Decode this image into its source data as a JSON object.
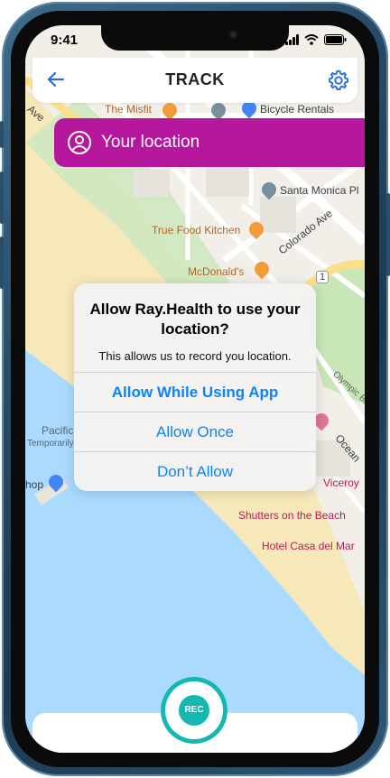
{
  "status_bar": {
    "time": "9:41"
  },
  "header": {
    "title": "TRACK"
  },
  "location_bar": {
    "label": "Your location"
  },
  "map": {
    "labels": {
      "misfit": "The Misfit",
      "bicycle_rentals": "Bicycle Rentals",
      "santa_monica": "Santa Monica Pl",
      "true_food": "True Food Kitchen",
      "colorado_ave": "Colorado Ave",
      "mcdonalds": "McDonald's",
      "ave_left": "Ave",
      "pacific": "Pacific",
      "temporarily": "Temporarily",
      "shop": "hop",
      "olympic": "Olympic Bl",
      "ocean": "Ocean",
      "viceroy": "Viceroy",
      "shutters": "Shutters on the Beach",
      "casa_del_mar": "Hotel Casa del Mar",
      "route_1": "1"
    },
    "colors": {
      "water": "#aadaff",
      "sand": "#f6e8b8",
      "park": "#c8e6b7",
      "road": "#ffffff",
      "highway": "#fbe08b"
    }
  },
  "alert": {
    "title": "Allow Ray.Health to use your location?",
    "message": "This allows us to record you location.",
    "buttons": {
      "allow_while_using": "Allow While Using App",
      "allow_once": "Allow Once",
      "dont_allow": "Don’t Allow"
    }
  },
  "record": {
    "label": "REC"
  },
  "colors": {
    "accent_purple": "#b5189d",
    "accent_teal": "#14b8b0",
    "ios_blue": "#0a84ff",
    "header_back": "#2f6fd6"
  },
  "icons": {
    "back": "arrow-left-icon",
    "settings": "gear-icon",
    "location": "user-circle-icon"
  }
}
